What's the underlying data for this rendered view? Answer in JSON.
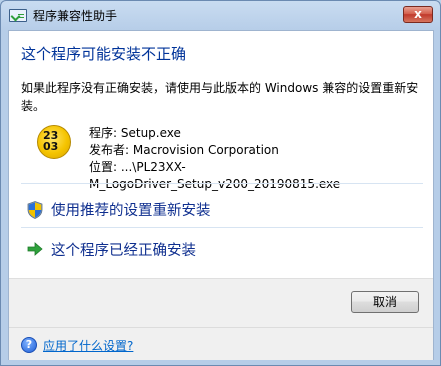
{
  "window": {
    "title": "程序兼容性助手",
    "close_glyph": "x"
  },
  "main": {
    "heading": "这个程序可能安装不正确",
    "description": "如果此程序没有正确安装，请使用与此版本的 Windows 兼容的设置重新安装。",
    "program_icon_text": [
      "23",
      "03"
    ],
    "program_line": "程序: Setup.exe",
    "publisher_line": "发布者: Macrovision Corporation",
    "location_line": "位置: ...\\PL23XX-M_LogoDriver_Setup_v200_20190815.exe"
  },
  "options": [
    {
      "label": "使用推荐的设置重新安装",
      "icon": "uac-shield-icon"
    },
    {
      "label": "这个程序已经正确安装",
      "icon": "green-arrow-icon"
    }
  ],
  "footer": {
    "cancel_label": "取消",
    "help_link": "应用了什么设置?"
  }
}
